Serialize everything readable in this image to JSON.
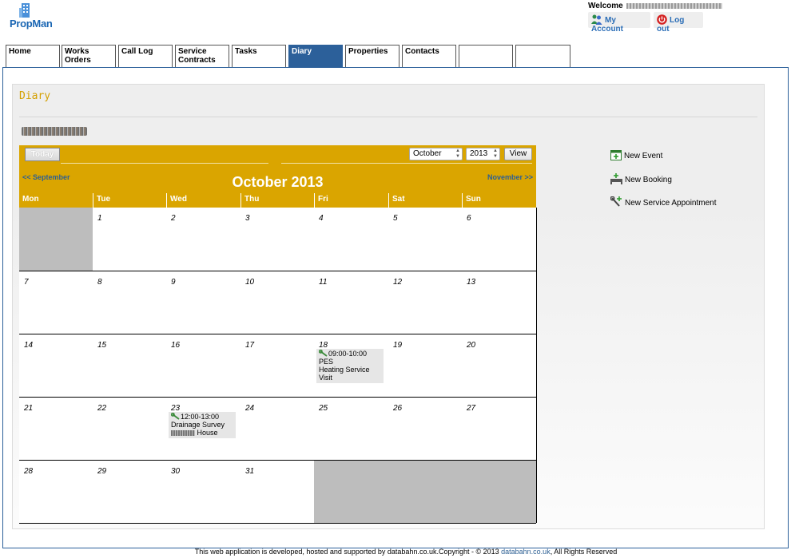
{
  "app": {
    "name": "PropMan"
  },
  "header": {
    "welcome_label": "Welcome",
    "my_account_label": "My Account",
    "logout_label": "Log out"
  },
  "tabs": [
    {
      "label": "Home"
    },
    {
      "label": "Works Orders"
    },
    {
      "label": "Call Log"
    },
    {
      "label": "Service\nContracts"
    },
    {
      "label": "Tasks"
    },
    {
      "label": "Diary",
      "active": true
    },
    {
      "label": "Properties"
    },
    {
      "label": "Contacts"
    },
    {
      "label": ""
    },
    {
      "label": ""
    }
  ],
  "diary": {
    "title": "Diary",
    "today_label": "Today",
    "month_select": "October",
    "year_select": "2013",
    "view_label": "View",
    "prev_label": "<< September",
    "next_label": "November >>",
    "month_title": "October 2013",
    "weekdays": [
      "Mon",
      "Tue",
      "Wed",
      "Thu",
      "Fri",
      "Sat",
      "Sun"
    ],
    "weeks": [
      [
        "",
        "1",
        "2",
        "3",
        "4",
        "5",
        "6"
      ],
      [
        "7",
        "8",
        "9",
        "10",
        "11",
        "12",
        "13"
      ],
      [
        "14",
        "15",
        "16",
        "17",
        "18",
        "19",
        "20"
      ],
      [
        "21",
        "22",
        "23",
        "24",
        "25",
        "26",
        "27"
      ],
      [
        "28",
        "29",
        "30",
        "31",
        "",
        "",
        ""
      ]
    ],
    "events": {
      "e18": {
        "time": "09:00-10:00 PES",
        "desc": "Heating Service Visit"
      },
      "e23": {
        "time": "12:00-13:00",
        "desc": "Drainage Survey",
        "place": "House"
      }
    }
  },
  "side_actions": {
    "new_event": "New Event",
    "new_booking": "New Booking",
    "new_service_appointment": "New Service Appointment"
  },
  "footer": {
    "text_before": "This web application is developed, hosted and supported by databahn.co.uk.Copyright - © 2013 ",
    "link": "databahn.co.uk",
    "text_after": ", All Rights Reserved"
  },
  "colors": {
    "accent": "#daa500",
    "brand": "#2c609a",
    "link": "#2c5f93",
    "empty_cell": "#bdbdbd"
  }
}
